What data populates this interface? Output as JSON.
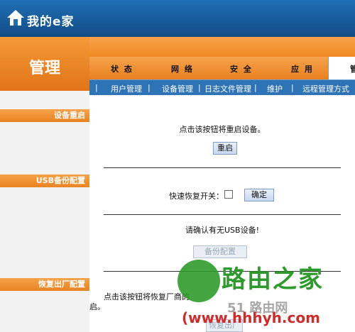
{
  "header": {
    "logo_text": "我的e家"
  },
  "section": {
    "title": "管理"
  },
  "tabs": [
    "状 态",
    "网 络",
    "安 全",
    "应 用"
  ],
  "active_tab": "管",
  "subnav": [
    "用户管理",
    "设备管理",
    "日志文件管理",
    "维护",
    "远程管理方式"
  ],
  "sidebar": {
    "labels": [
      "设备重启",
      "USB备份配置",
      "恢复出厂配置"
    ]
  },
  "reboot": {
    "desc": "点击该按钮将重启设备。",
    "button": "重启"
  },
  "usb": {
    "quick_restore_label": "快速恢复开关：",
    "confirm_button": "确定",
    "confirm_usb_text": "请确认有无USB设备!",
    "backup_button": "备份配置"
  },
  "factory_reset": {
    "desc_prefix": "点击该按钮将恢复厂商的",
    "desc_suffix": "启。",
    "button": "恢复出厂"
  },
  "watermark": {
    "brand": "路由之家",
    "url": "(www.hhhyh.com",
    "small": "51 路由网"
  },
  "colors": {
    "header_blue": "#1f6fb3",
    "orange": "#f08a22",
    "subnav_blue": "#2f73b7",
    "watermark_green": "#2d9b2b",
    "watermark_red": "#d12a2a"
  }
}
